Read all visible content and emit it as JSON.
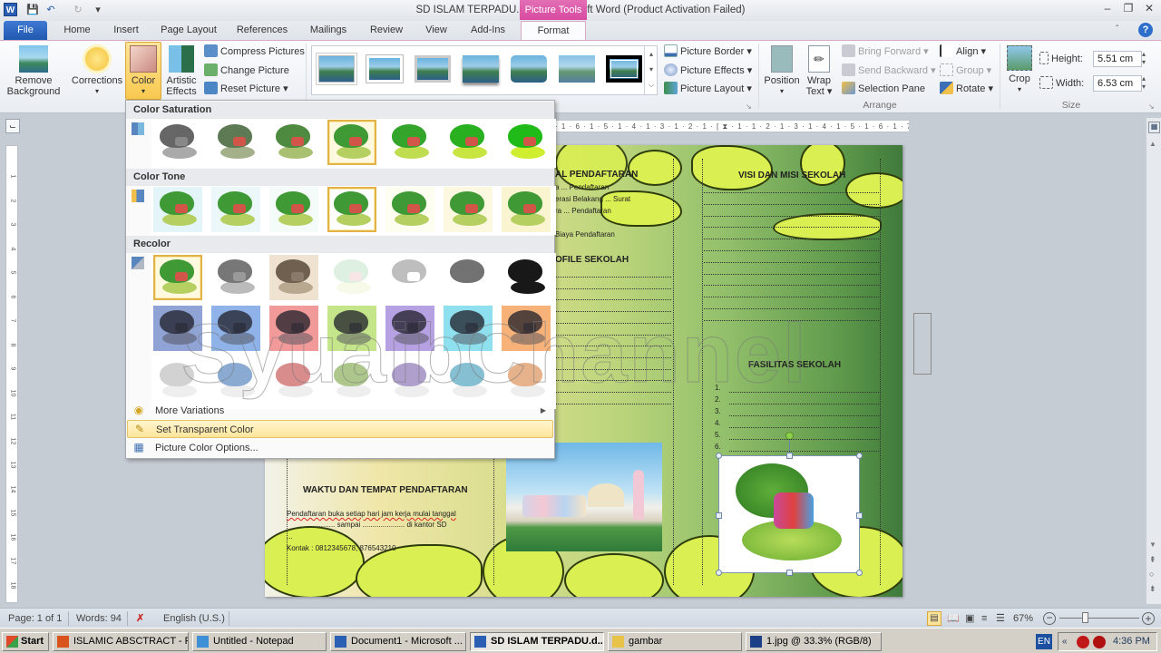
{
  "window": {
    "title": "SD ISLAM TERPADU.docx  -  Microsoft Word (Product Activation Failed)",
    "app_icon": "word-icon",
    "quick_access": [
      "save-icon",
      "undo-icon",
      "redo-icon",
      "customize-icon"
    ],
    "context_tab_group": "Picture Tools",
    "controls": {
      "minimize": "–",
      "restore": "❐",
      "close": "✕"
    }
  },
  "tabs": [
    "File",
    "Home",
    "Insert",
    "Page Layout",
    "References",
    "Mailings",
    "Review",
    "View",
    "Add-Ins",
    "Format"
  ],
  "active_tab": "Format",
  "ribbon": {
    "adjust": {
      "remove_background": [
        "Remove",
        "Background"
      ],
      "corrections": "Corrections",
      "color": "Color",
      "artistic_effects": [
        "Artistic",
        "Effects ▾"
      ],
      "compress": "Compress Pictures",
      "change": "Change Picture",
      "reset": "Reset Picture ▾"
    },
    "picture_styles": {
      "count": 7,
      "border": "Picture Border ▾",
      "effects": "Picture Effects ▾",
      "layout": "Picture Layout ▾"
    },
    "arrange": {
      "label": "Arrange",
      "position": "Position",
      "wrap_text": [
        "Wrap",
        "Text ▾"
      ],
      "bring_forward": "Bring Forward ▾",
      "send_backward": "Send Backward ▾",
      "selection_pane": "Selection Pane",
      "align": "Align ▾",
      "group": "Group ▾",
      "rotate": "Rotate ▾"
    },
    "size": {
      "label": "Size",
      "crop": "Crop",
      "height_label": "Height:",
      "height_value": "5.51 cm",
      "width_label": "Width:",
      "width_value": "6.53 cm"
    }
  },
  "color_menu": {
    "sections": [
      {
        "title": "Color Saturation",
        "selected_index": 3,
        "count": 7
      },
      {
        "title": "Color Tone",
        "selected_index": 3,
        "count": 7
      },
      {
        "title": "Recolor",
        "selected_index": 0,
        "rows": 3
      }
    ],
    "items": [
      {
        "label": "More Variations",
        "icon": "palette-icon",
        "submenu": true
      },
      {
        "label": "Set Transparent Color",
        "icon": "pen-icon",
        "highlighted": true
      },
      {
        "label": "Picture Color Options...",
        "icon": "picture-color-icon"
      }
    ],
    "recolor_tints": [
      "#8fa3d4",
      "#8fb2e8",
      "#f19a99",
      "#c4e58a",
      "#b6a1e3",
      "#8ee0ef",
      "#f7b27a"
    ]
  },
  "ruler": {
    "horizontal": "· 1 · 6 · 1 · 5 · 1 · 4 · 1 · 3 · 1 · 2 · 1 · [    ⧗ · 1 · 1 · 2 · 1 · 3 · 1 · 4 · 1 · 5 · 1 · 6 · 1 · 7 · 1 · 8 · △ · 9 ·",
    "vertical": [
      "1",
      "2",
      "3",
      "4",
      "5",
      "6",
      "7",
      "8",
      "9",
      "10",
      "11",
      "12",
      "13",
      "14",
      "15",
      "16",
      "17",
      "18"
    ]
  },
  "document": {
    "heading_top_left": "AL PENDAFTARAN",
    "lines_top_left": [
      "a ... Pendaftaran",
      "erasi Belakang ... Surat",
      "ra ... Pendaftaran"
    ],
    "biaya": "Biaya Pendaftaran",
    "profile": "OFILE SEKOLAH",
    "visi_misi": "VISI DAN MISI SEKOLAH",
    "fasilitas": "FASILITAS SEKOLAH",
    "fasilitas_list": [
      "1.",
      "2.",
      "3.",
      "4.",
      "5.",
      "6."
    ],
    "waktu_title": "WAKTU DAN TEMPAT PENDAFTARAN",
    "waktu_lines": [
      "Pendaftaran buka setiap hari jam kerja mulai tanggal",
      "............... sampai ..................... di kantor SD",
      "...",
      "Kontak : 0812345678, 876543210"
    ]
  },
  "watermark": "SyuaibChannel",
  "status_bar": {
    "page": "Page: 1 of 1",
    "words": "Words: 94",
    "language": "English (U.S.)",
    "zoom": "67%",
    "zoom_percent": 67
  },
  "taskbar": {
    "start": "Start",
    "tasks": [
      {
        "label": "ISLAMIC ABSCTRACT - P...",
        "icon": "firefox-icon",
        "color": "#d9541c"
      },
      {
        "label": "Untitled - Notepad",
        "icon": "notepad-icon",
        "color": "#3d8fd6"
      },
      {
        "label": "Document1 - Microsoft ...",
        "icon": "word-icon",
        "color": "#2b5fb4"
      },
      {
        "label": "SD ISLAM TERPADU.d...",
        "icon": "word-icon",
        "color": "#2b5fb4",
        "active": true
      },
      {
        "label": "gambar",
        "icon": "folder-icon",
        "color": "#e8c34a"
      },
      {
        "label": "1.jpg @ 33.3% (RGB/8)",
        "icon": "photoshop-icon",
        "color": "#1c3f87"
      }
    ],
    "lang": "EN",
    "time": "4:36 PM"
  }
}
